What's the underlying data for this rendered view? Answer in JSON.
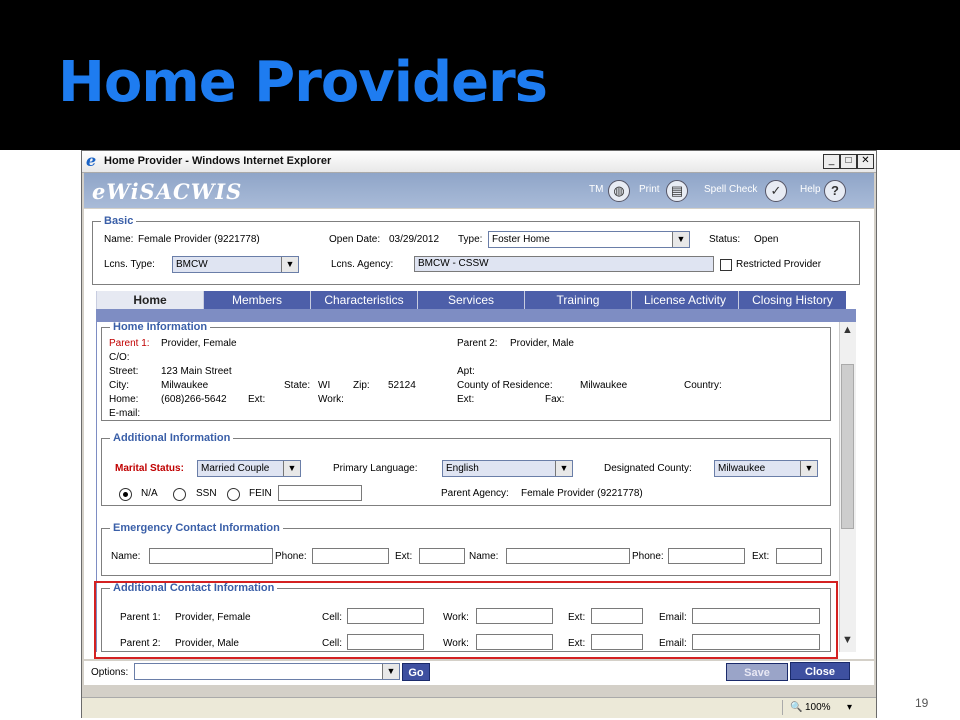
{
  "slide": {
    "title": "Home Providers",
    "page_number": "19"
  },
  "window": {
    "title": "Home Provider - Windows Internet Explorer",
    "min": "_",
    "max": "□",
    "close": "✕"
  },
  "app": {
    "logo": "eWiSACWIS",
    "links": {
      "tm": "TM",
      "print": "Print",
      "spell": "Spell Check",
      "help": "Help"
    }
  },
  "basic": {
    "legend": "Basic",
    "name_label": "Name:",
    "name_value": "Female Provider (9221778)",
    "open_date_label": "Open Date:",
    "open_date_value": "03/29/2012",
    "type_label": "Type:",
    "type_value": "Foster Home",
    "status_label": "Status:",
    "status_value": "Open",
    "lcns_type_label": "Lcns. Type:",
    "lcns_type_value": "BMCW",
    "lcns_agency_label": "Lcns. Agency:",
    "lcns_agency_value": "BMCW - CSSW",
    "restricted_label": "Restricted Provider"
  },
  "tabs": [
    "Home",
    "Members",
    "Characteristics",
    "Services",
    "Training",
    "License Activity",
    "Closing History"
  ],
  "home_info": {
    "legend": "Home Information",
    "parent1_label": "Parent 1:",
    "parent1_value": "Provider, Female",
    "parent2_label": "Parent 2:",
    "parent2_value": "Provider, Male",
    "co_label": "C/O:",
    "street_label": "Street:",
    "street_value": "123 Main Street",
    "apt_label": "Apt:",
    "city_label": "City:",
    "city_value": "Milwaukee",
    "state_label": "State:",
    "state_value": "WI",
    "zip_label": "Zip:",
    "zip_value": "52124",
    "county_label": "County of Residence:",
    "county_value": "Milwaukee",
    "country_label": "Country:",
    "home_label": "Home:",
    "home_value": "(608)266-5642",
    "ext_label": "Ext:",
    "work_label": "Work:",
    "ext2_label": "Ext:",
    "fax_label": "Fax:",
    "email_label": "E-mail:"
  },
  "additional_info": {
    "legend": "Additional Information",
    "marital_label": "Marital Status:",
    "marital_value": "Married Couple",
    "language_label": "Primary Language:",
    "language_value": "English",
    "county_label": "Designated County:",
    "county_value": "Milwaukee",
    "radio_na": "N/A",
    "radio_ssn": "SSN",
    "radio_fein": "FEIN",
    "parent_agency_label": "Parent Agency:",
    "parent_agency_value": "Female Provider (9221778)"
  },
  "emergency": {
    "legend": "Emergency Contact Information",
    "name_label": "Name:",
    "phone_label": "Phone:",
    "ext_label": "Ext:"
  },
  "additional_contact": {
    "legend": "Additional Contact Information",
    "rows": [
      {
        "parent_label": "Parent 1:",
        "parent_value": "Provider, Female"
      },
      {
        "parent_label": "Parent 2:",
        "parent_value": "Provider, Male"
      }
    ],
    "cell_label": "Cell:",
    "work_label": "Work:",
    "ext_label": "Ext:",
    "email_label": "Email:"
  },
  "footer": {
    "options_label": "Options:",
    "go_label": "Go",
    "save_label": "Save",
    "close_label": "Close"
  },
  "statusbar": {
    "zoom": "100%"
  },
  "colors": {
    "accent": "#1e7cf0",
    "tab_bg": "#4d5fa9",
    "legend": "#3a5fa8",
    "highlight_box": "#d42121",
    "required": "#c00000"
  }
}
